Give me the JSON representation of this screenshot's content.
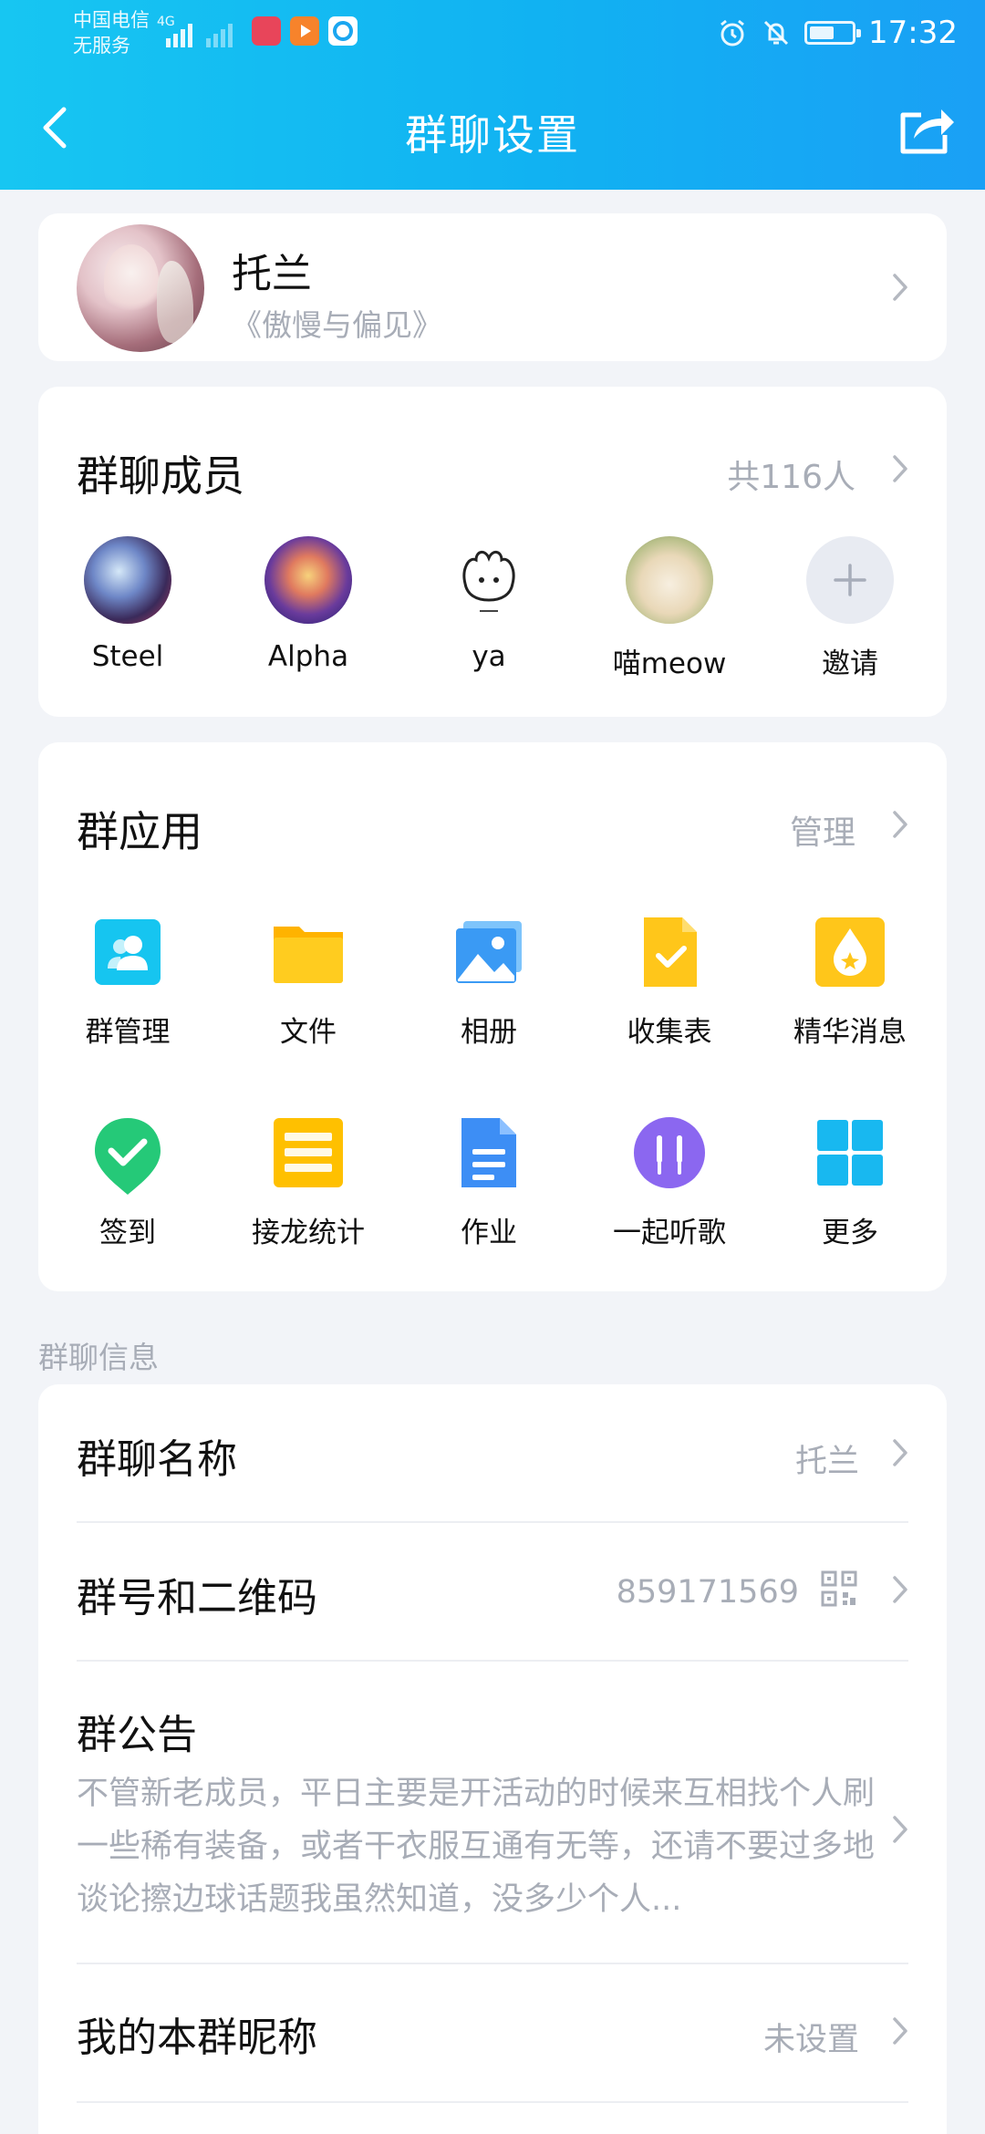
{
  "status_bar": {
    "carrier_line1": "中国电信",
    "carrier_line2": "无服务",
    "network": "4G",
    "time": "17:32",
    "battery_level": 0.6
  },
  "nav": {
    "title": "群聊设置",
    "icons": {
      "back": "chevron-left-icon",
      "share": "share-icon"
    }
  },
  "profile": {
    "name": "托兰",
    "subtitle": "《傲慢与偏见》"
  },
  "members": {
    "title": "群聊成员",
    "count": "共116人",
    "list": [
      {
        "name": "Steel"
      },
      {
        "name": "Alpha"
      },
      {
        "name": "ya"
      },
      {
        "name": "喵meow"
      },
      {
        "name": "邀请"
      }
    ]
  },
  "apps": {
    "title": "群应用",
    "manage": "管理",
    "items": [
      {
        "label": "群管理",
        "icon": "group-manage-icon",
        "color": "#16c5f0"
      },
      {
        "label": "文件",
        "icon": "folder-icon",
        "color": "#ffc61a"
      },
      {
        "label": "相册",
        "icon": "photo-album-icon",
        "color": "#3aa0f5"
      },
      {
        "label": "收集表",
        "icon": "form-collect-icon",
        "color": "#ffc61a"
      },
      {
        "label": "精华消息",
        "icon": "essence-icon",
        "color": "#ffc61a"
      },
      {
        "label": "签到",
        "icon": "check-in-icon",
        "color": "#25c978"
      },
      {
        "label": "接龙统计",
        "icon": "relay-stats-icon",
        "color": "#ffc000"
      },
      {
        "label": "作业",
        "icon": "homework-icon",
        "color": "#3d8ef5"
      },
      {
        "label": "一起听歌",
        "icon": "listen-together-icon",
        "color": "#8b67f0"
      },
      {
        "label": "更多",
        "icon": "more-grid-icon",
        "color": "#18b8f0"
      }
    ]
  },
  "info": {
    "heading": "群聊信息",
    "group_name_label": "群聊名称",
    "group_name_value": "托兰",
    "group_id_label": "群号和二维码",
    "group_id_value": "859171569",
    "notice_label": "群公告",
    "notice_text": "不管新老成员，平日主要是开活动的时候来互相找个人刷一些稀有装备，或者干衣服互通有无等，还请不要过多地谈论擦边球话题我虽然知道，没多少个人...",
    "nickname_label": "我的本群昵称",
    "nickname_value": "未设置"
  }
}
